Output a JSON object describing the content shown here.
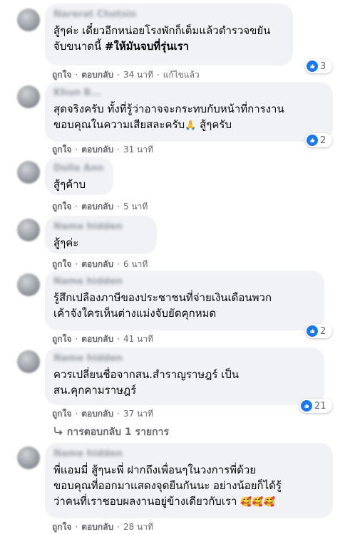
{
  "comments": [
    {
      "author": "Narerat Chotsin",
      "text_lines": [
        "สู้ๆค่ะ เดี๋ยวอีกหน่อยโรงพักก็เต็มแล้วตำรวจขยัน"
      ],
      "text_line2_plain": "จับขนาดนี้ ",
      "text_line2_bold": "#ให้มันจบที่รุ่นเรา",
      "like_label": "ถูกใจ",
      "reply_label": "ตอบกลับ",
      "time": "34 นาที",
      "edited": "แก้ไขแล้ว",
      "reactions": "3"
    },
    {
      "author": "Khun B...",
      "text_line1": "สุดจริงครับ ทั้งที่รู้ว่าอาจจะกระทบกับหน้าที่การงาน",
      "text_line2": "ขอบคุณในความเสียสละครับ",
      "text_line2_end": "สู้ๆครับ",
      "like_label": "ถูกใจ",
      "reply_label": "ตอบกลับ",
      "time": "31 นาที",
      "reactions": "2"
    },
    {
      "author": "Dolla Ann",
      "text": "สู้ๆค้าบ",
      "like_label": "ถูกใจ",
      "reply_label": "ตอบกลับ",
      "time": "5 นาที"
    },
    {
      "author": "Name hidden",
      "text": "สู้ๆค่ะ",
      "like_label": "ถูกใจ",
      "reply_label": "ตอบกลับ",
      "time": "6 นาที"
    },
    {
      "author": "Name hidden",
      "text_line1": "รู้สึกเปลืองภาษีของประชาชนที่จ่ายเงินเดือนพวก",
      "text_line2": "เค้าจังใครเห็นต่างแม่งจับยัดคุกหมด",
      "like_label": "ถูกใจ",
      "reply_label": "ตอบกลับ",
      "time": "41 นาที",
      "reactions": "2"
    },
    {
      "author": "Name hidden",
      "text_line1": "ควรเปลี่ยนชื่อจากสน.สำราญราษฎร์ เป็น",
      "text_line2": "สน.คุกคามราษฎร์",
      "like_label": "ถูกใจ",
      "reply_label": "ตอบกลับ",
      "time": "37 นาที",
      "reactions": "21",
      "replies_label": "การตอบกลับ 1 รายการ"
    },
    {
      "author": "Name hidden",
      "text_line1": "พี่แอมมี่ สู้ๆนะพี่ ฝากถึงเพื่อนๆในวงการพี่ด้วย",
      "text_line2": "ขอบคุณที่ออกมาแสดงจุดยืนกันนะ อย่างน้อยก็ได้รู้",
      "text_line3": "ว่าคนที่เราชอบผลงานอยู่ข้างเดียวกับเรา",
      "like_label": "ถูกใจ",
      "reply_label": "ตอบกลับ",
      "time": "28 นาที"
    }
  ],
  "separator": "·",
  "colors": {
    "like_blue": "#1877f2",
    "bubble": "#f0f2f5",
    "meta": "#65676b"
  }
}
